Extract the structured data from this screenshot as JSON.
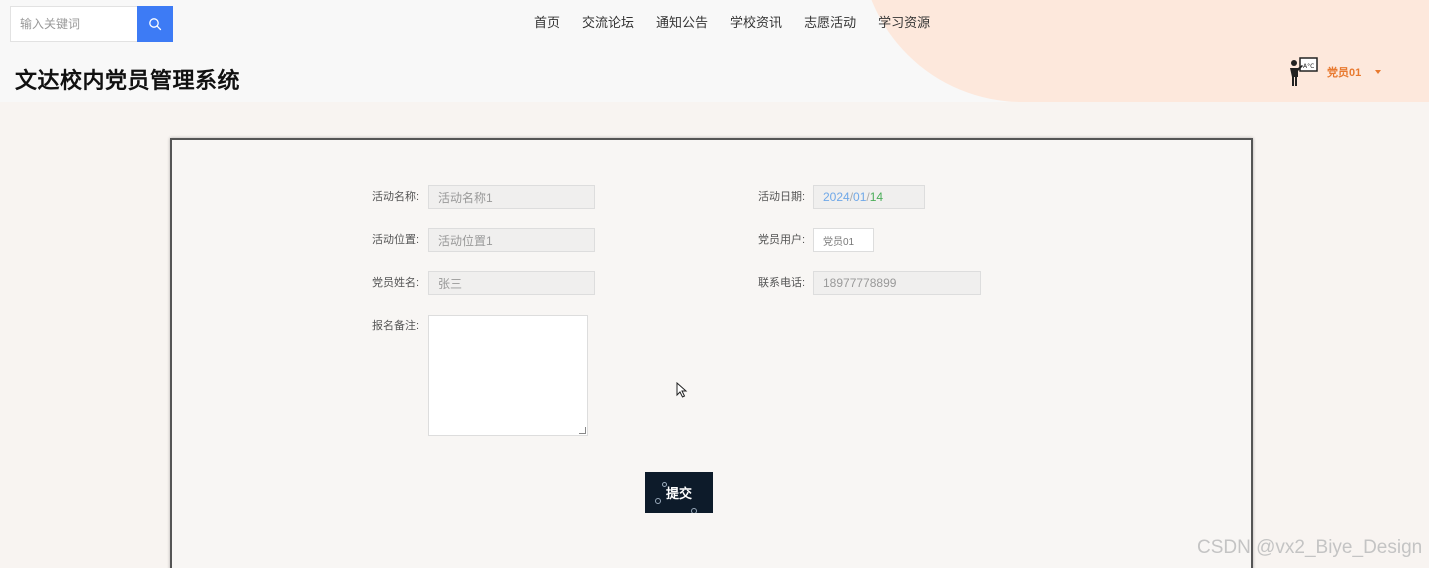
{
  "search": {
    "placeholder": "输入关键词",
    "icon": "search-icon"
  },
  "nav": {
    "items": [
      {
        "label": "首页"
      },
      {
        "label": "交流论坛"
      },
      {
        "label": "通知公告"
      },
      {
        "label": "学校资讯"
      },
      {
        "label": "志愿活动"
      },
      {
        "label": "学习资源"
      }
    ]
  },
  "header": {
    "title": "文达校内党员管理系统"
  },
  "user": {
    "name": "党员01",
    "avatar_icon": "teacher-board-icon",
    "accent": "#e8792f"
  },
  "form": {
    "activity_name": {
      "label": "活动名称:",
      "value": "活动名称1"
    },
    "activity_date": {
      "label": "活动日期:",
      "year": "2024",
      "month": "01",
      "day": "14",
      "sep": "/"
    },
    "activity_location": {
      "label": "活动位置:",
      "value": "活动位置1"
    },
    "member_user": {
      "label": "党员用户:",
      "value": "党员01"
    },
    "member_name": {
      "label": "党员姓名:",
      "value": "张三"
    },
    "phone": {
      "label": "联系电话:",
      "value": "18977778899"
    },
    "remark": {
      "label": "报名备注:",
      "value": ""
    },
    "submit_label": "提交"
  },
  "colors": {
    "primary": "#3d7bf5",
    "submit_bg": "#0d1b2a",
    "header_accent": "#fde8dc"
  },
  "watermark": "CSDN @vx2_Biye_Design"
}
